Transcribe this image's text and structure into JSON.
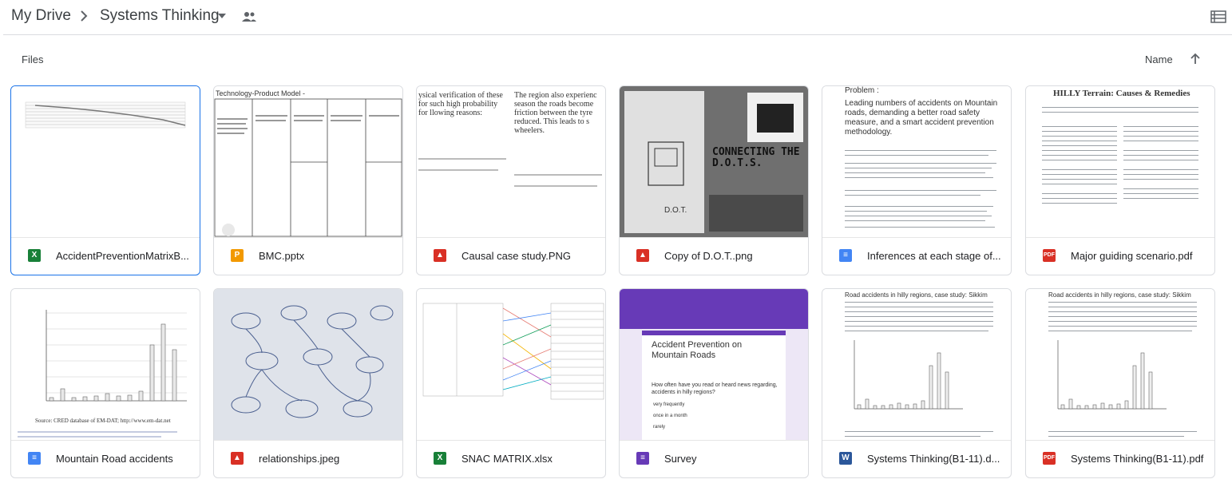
{
  "breadcrumb": {
    "root": "My Drive",
    "folder": "Systems Thinking"
  },
  "section": {
    "label": "Files",
    "sort_label": "Name"
  },
  "files": [
    {
      "name": "AccidentPreventionMatrixB...",
      "type": "sheet",
      "icon_text": "X"
    },
    {
      "name": "BMC.pptx",
      "type": "slides",
      "icon_text": "P"
    },
    {
      "name": "Causal case study.PNG",
      "type": "image",
      "icon_text": ""
    },
    {
      "name": "Copy of D.O.T..png",
      "type": "image",
      "icon_text": ""
    },
    {
      "name": "Inferences at each stage of...",
      "type": "doc",
      "icon_text": ""
    },
    {
      "name": "Major guiding scenario.pdf",
      "type": "pdf",
      "icon_text": "PDF"
    },
    {
      "name": "Mountain Road accidents",
      "type": "doc",
      "icon_text": ""
    },
    {
      "name": "relationships.jpeg",
      "type": "image",
      "icon_text": ""
    },
    {
      "name": "SNAC MATRIX.xlsx",
      "type": "sheet",
      "icon_text": "X"
    },
    {
      "name": "Survey",
      "type": "form",
      "icon_text": ""
    },
    {
      "name": "Systems Thinking(B1-11).d...",
      "type": "word",
      "icon_text": "W"
    },
    {
      "name": "Systems Thinking(B1-11).pdf",
      "type": "pdf",
      "icon_text": "PDF"
    }
  ],
  "thumb_text": {
    "bmc_title": "Technology-Product Model -",
    "dot_title": "CONNECTING THE D.O.T.S.",
    "dot_label": "D.O.T.",
    "problem_title": "Problem :",
    "problem_body": "Leading numbers of accidents on Mountain roads, demanding a better road safety measure, and a smart accident prevention methodology.",
    "scenario_title": "HILLY Terrain: Causes & Remedies",
    "survey_title": "Accident Prevention on Mountain Roads",
    "survey_question": "How often have you read or heard news regarding, accidents in hilly regions?",
    "survey_options": [
      "very frequently",
      "once in a month",
      "rarely"
    ],
    "road_title": "Road accidents in hilly regions, case study: Sikkim",
    "causal_col1": "ysical verification of these for such high probability for llowing reasons:",
    "causal_col2": "The region also experienc season the roads become friction between the tyre reduced. This leads to s wheelers.",
    "source_note": "Source: CRED database of EM-DAT; http://www.em-dat.net"
  },
  "colors": {
    "accent": "#1a73e8",
    "border": "#dadce0",
    "survey_purple": "#673ab7"
  }
}
